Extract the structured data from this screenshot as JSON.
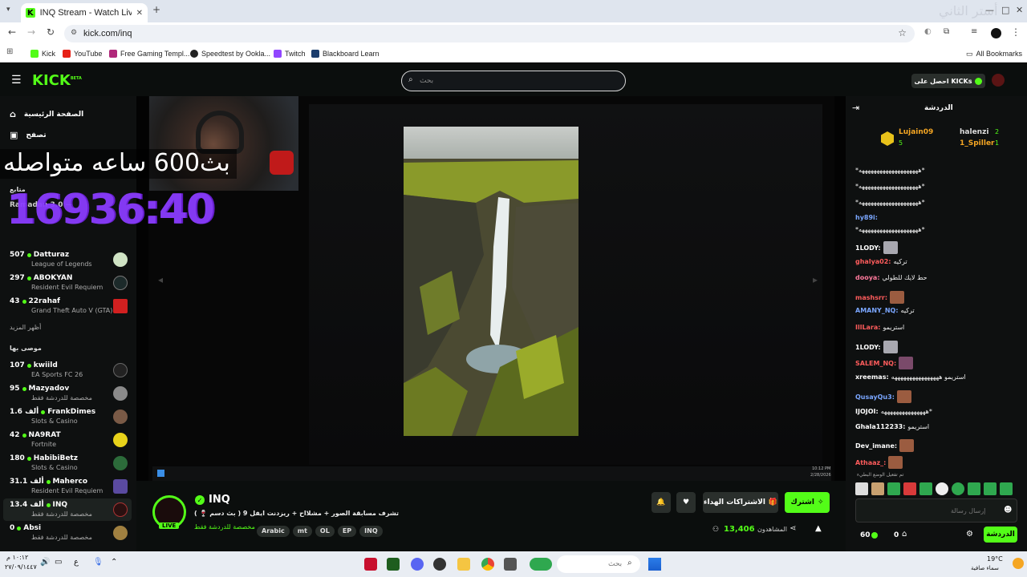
{
  "browser": {
    "tab_title": "INQ Stream - Watch Live or",
    "url": "kick.com/inq",
    "bookmarks": [
      "Kick",
      "YouTube",
      "Free Gaming Templ...",
      "Speedtest by Ookla...",
      "Twitch",
      "Blackboard Learn"
    ],
    "all_bookmarks": "All Bookmarks",
    "corner_text": "أستر الثاني"
  },
  "header": {
    "logo": "KICK",
    "logo_sup": "BETA",
    "search_placeholder": "بحث",
    "get_kicks": "احصل على KICKs"
  },
  "sidebar": {
    "nav": [
      "الصفحة الرئيسية",
      "تصفح"
    ],
    "following_head": "متابع",
    "partial_row": "Ramadan 3.0 —",
    "following": [
      {
        "count": "507",
        "name": "Datturaz",
        "sub": "League of Legends"
      },
      {
        "count": "297",
        "name": "ABOKYAN",
        "sub": "Resident Evil Requiem"
      },
      {
        "count": "43",
        "name": "22rahaf",
        "sub": "Grand Theft Auto V (GTA)"
      }
    ],
    "show_more": "أظهر المزيد",
    "recommended_head": "موصى بها",
    "recommended": [
      {
        "count": "107",
        "name": "kwiild",
        "sub": "EA Sports FC 26"
      },
      {
        "count": "95",
        "name": "Mazyadov",
        "sub": "مخصصة للدردشة فقط"
      },
      {
        "count": "1.6 ألف",
        "name": "FrankDimes",
        "sub": "Slots & Casino"
      },
      {
        "count": "42",
        "name": "NA9RAT",
        "sub": "Fortnite"
      },
      {
        "count": "180",
        "name": "HabibiBetz",
        "sub": "Slots & Casino"
      },
      {
        "count": "31.1 ألف",
        "name": "Maherco",
        "sub": "Resident Evil Requiem"
      },
      {
        "count": "13.4 ألف",
        "name": "INQ",
        "sub": "مخصصة للدردشة فقط"
      },
      {
        "count": "0",
        "name": "Absi",
        "sub": "مخصصة للدردشة فقط"
      }
    ]
  },
  "video": {
    "overlay_text": "بث600 ساعه متواصله",
    "timer": "16936:40",
    "inner_clock": "10:12 PM",
    "inner_date": "2/28/2026"
  },
  "stream": {
    "name": "INQ",
    "live": "LIVE",
    "title": "تشرف مسابقة الصور + مشلااح + ريزدنت ايفل 9 ( بث دسم 🍷 )",
    "category": "مخصصة للدردشة فقط",
    "tags": [
      "Arabic",
      "mt",
      "OL",
      "EP",
      "INQ"
    ],
    "viewers": "13,406",
    "viewers_label": "المشاهدون",
    "subscribe": "اشترك",
    "gift_subs": "الاشتراكات الهداء"
  },
  "chat": {
    "title": "الدردشة",
    "leaders": [
      {
        "name": "Lujain09",
        "value": "5"
      },
      {
        "name": "halenzi",
        "value": "2"
      },
      {
        "name": "1_Spiller",
        "value": "1"
      }
    ],
    "messages": [
      {
        "user": "",
        "text": "*ههههههههههههههههههههه*",
        "color": "#ffffff"
      },
      {
        "user": "",
        "text": "*ههههههههههههههههههههه*",
        "color": "#ffffff"
      },
      {
        "user": "",
        "text": "*ههههههههههههههههههههه*",
        "color": "#ffffff"
      },
      {
        "user": "hy89i:",
        "text": "",
        "color": "#7aa6ff"
      },
      {
        "user": "",
        "text": "*ههههههههههههههههههههه*",
        "color": "#ffffff"
      },
      {
        "user": "1LODY:",
        "text": "",
        "color": "#ffffff"
      },
      {
        "user": "ghalya02:",
        "text": "تركيه",
        "color": "#ff5c5c"
      },
      {
        "user": "dooya:",
        "text": "حط لايك للطولي",
        "color": "#ff7a9c"
      },
      {
        "user": "mashsrr:",
        "text": "",
        "color": "#ff5c5c"
      },
      {
        "user": "AMANY_NQ:",
        "text": "تركيه",
        "color": "#7aa6ff"
      },
      {
        "user": "IllLara:",
        "text": "استريمو",
        "color": "#ff5c5c"
      },
      {
        "user": "1LODY:",
        "text": "",
        "color": "#ffffff"
      },
      {
        "user": "SALEM_NQ:",
        "text": "",
        "color": "#ff5c5c"
      },
      {
        "user": "xreemas:",
        "text": "استريمو ههههههههههههههههه",
        "color": "#ffffff"
      },
      {
        "user": "QusayQu3:",
        "text": "",
        "color": "#7aa6ff"
      },
      {
        "user": "IJOJOI:",
        "text": "هههههههههههههههه*",
        "color": "#ffffff"
      },
      {
        "user": "Ghala112233:",
        "text": "استريمو",
        "color": "#ffffff"
      },
      {
        "user": "Dev_imane:",
        "text": "",
        "color": "#ffffff"
      },
      {
        "user": "Athaaz_:",
        "text": "",
        "color": "#ff5c5c"
      }
    ],
    "notice": "تم تفعيل الوضع البطيء",
    "input_placeholder": "إرسال رسالة",
    "points": "60",
    "counter": "0",
    "send": "الدردشة"
  },
  "taskbar": {
    "search_placeholder": "بحث",
    "weather_temp": "19°C",
    "weather_text": "سماء صافية",
    "time": "١٠:١٢ م",
    "date": "٢٧/٠٩/١٤٤٧"
  }
}
